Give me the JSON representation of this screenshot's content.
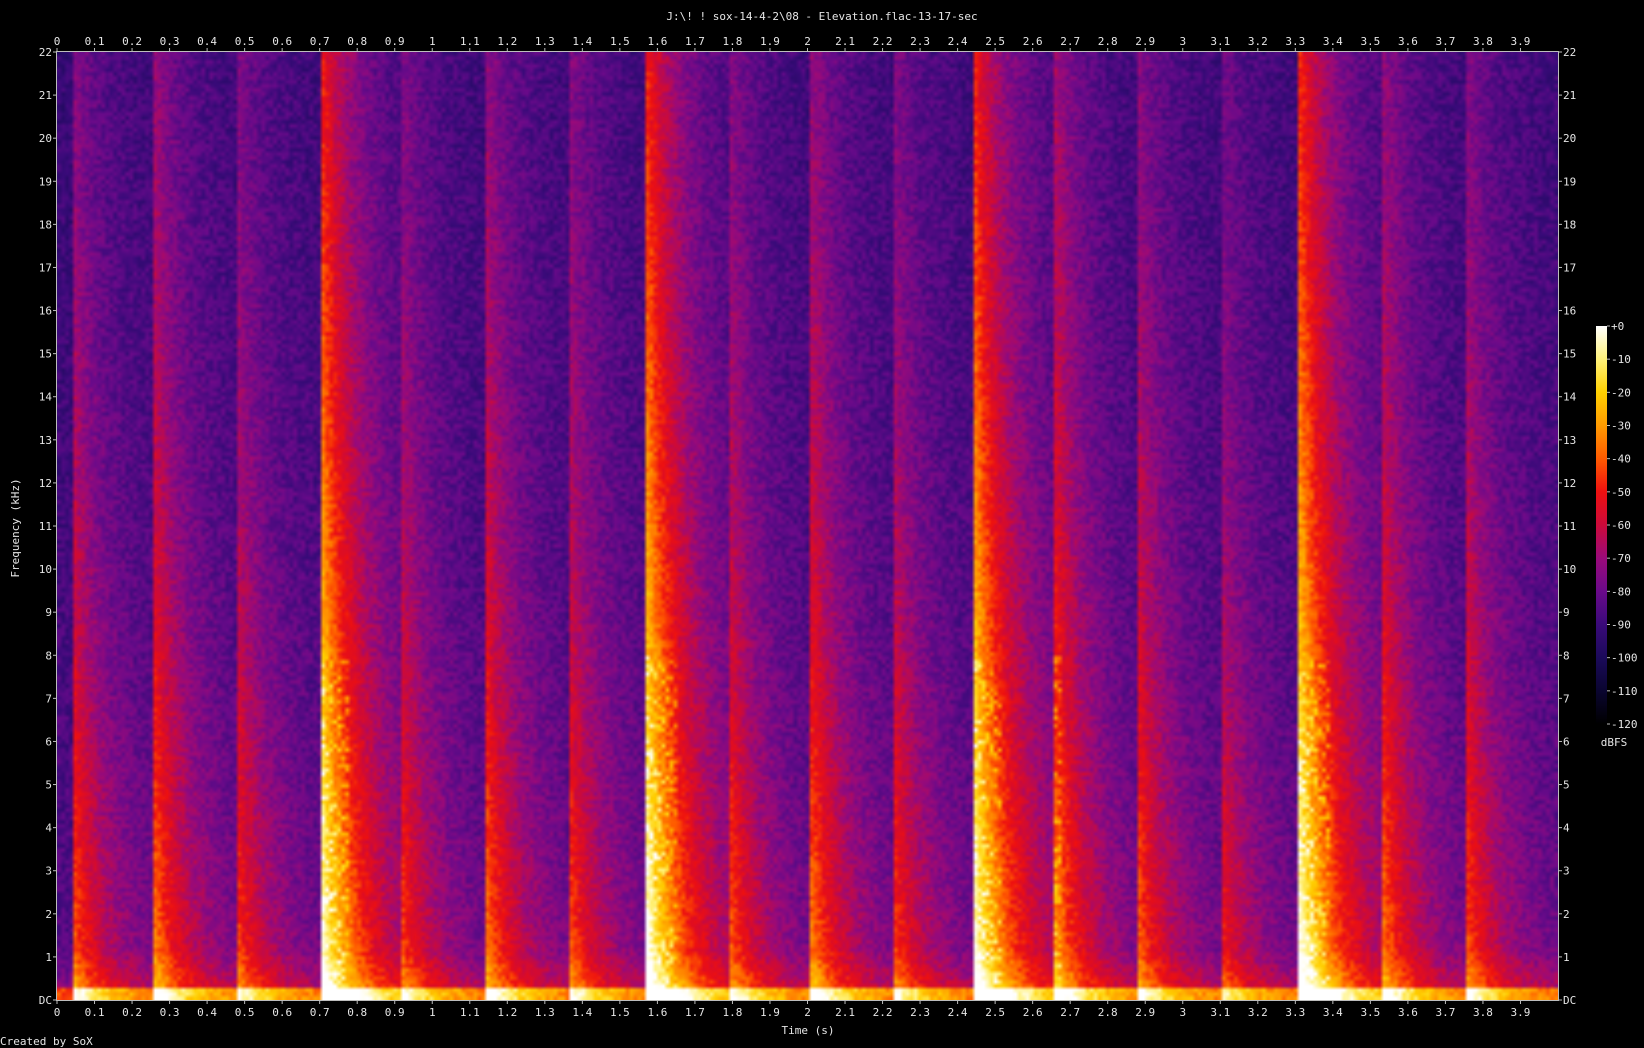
{
  "window": {
    "title": "J:\\! ! sox-14-4-2\\08 - Elevation.flac-13-17-sec",
    "footer": "Created by SoX"
  },
  "chart_data": {
    "type": "heatmap",
    "title": "J:\\! ! sox-14-4-2\\08 - Elevation.flac-13-17-sec",
    "xlabel": "Time (s)",
    "ylabel": "Frequency (kHz)",
    "xlim": [
      0,
      4.0
    ],
    "ylim": [
      0,
      22
    ],
    "x_ticks": [
      "0",
      "0.1",
      "0.2",
      "0.3",
      "0.4",
      "0.5",
      "0.6",
      "0.7",
      "0.8",
      "0.9",
      "1",
      "1.1",
      "1.2",
      "1.3",
      "1.4",
      "1.5",
      "1.6",
      "1.7",
      "1.8",
      "1.9",
      "2",
      "2.1",
      "2.2",
      "2.3",
      "2.4",
      "2.5",
      "2.6",
      "2.7",
      "2.8",
      "2.9",
      "3",
      "3.1",
      "3.2",
      "3.3",
      "3.4",
      "3.5",
      "3.6",
      "3.7",
      "3.8",
      "3.9"
    ],
    "y_ticks": [
      "DC",
      "1",
      "2",
      "3",
      "4",
      "5",
      "6",
      "7",
      "8",
      "9",
      "10",
      "11",
      "12",
      "13",
      "14",
      "15",
      "16",
      "17",
      "18",
      "19",
      "20",
      "21",
      "22"
    ],
    "colorbar": {
      "label": "dBFS",
      "range": [
        -120,
        0
      ],
      "ticks": [
        "+0",
        "-10",
        "-20",
        "-30",
        "-40",
        "-50",
        "-60",
        "-70",
        "-80",
        "-90",
        "-100",
        "-110",
        "-120"
      ],
      "colors": [
        "#000000",
        "#0a0530",
        "#1b0a5a",
        "#3a0a7a",
        "#6a0a8a",
        "#9a0a7a",
        "#cc0a3a",
        "#ee1010",
        "#ff5a00",
        "#ff9a00",
        "#ffd000",
        "#fff27a",
        "#ffffff"
      ]
    },
    "onsets": [
      {
        "time": 0.04,
        "strength": 0.55
      },
      {
        "time": 0.26,
        "strength": 0.6
      },
      {
        "time": 0.48,
        "strength": 0.5
      },
      {
        "time": 0.7,
        "strength": 1.0
      },
      {
        "time": 0.92,
        "strength": 0.5
      },
      {
        "time": 1.14,
        "strength": 0.6
      },
      {
        "time": 1.36,
        "strength": 0.55
      },
      {
        "time": 1.57,
        "strength": 1.0
      },
      {
        "time": 1.79,
        "strength": 0.55
      },
      {
        "time": 2.01,
        "strength": 0.6
      },
      {
        "time": 2.23,
        "strength": 0.5
      },
      {
        "time": 2.44,
        "strength": 1.0
      },
      {
        "time": 2.66,
        "strength": 0.65
      },
      {
        "time": 2.88,
        "strength": 0.55
      },
      {
        "time": 3.1,
        "strength": 0.45
      },
      {
        "time": 3.31,
        "strength": 1.0
      },
      {
        "time": 3.53,
        "strength": 0.6
      },
      {
        "time": 3.75,
        "strength": 0.55
      }
    ]
  }
}
